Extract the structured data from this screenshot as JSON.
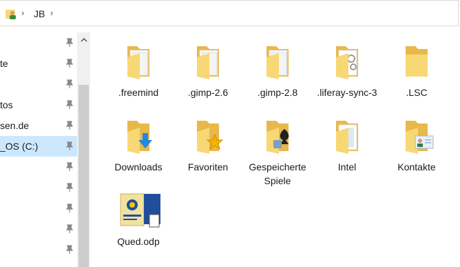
{
  "address": {
    "crumb": "JB"
  },
  "nav": {
    "items": [
      {
        "label": ""
      },
      {
        "label": "te"
      },
      {
        "label": ""
      },
      {
        "label": "tos"
      },
      {
        "label": "sen.de"
      },
      {
        "label": "_OS (C:)"
      },
      {
        "label": ""
      },
      {
        "label": ""
      },
      {
        "label": ""
      },
      {
        "label": ""
      },
      {
        "label": ""
      }
    ]
  },
  "files": [
    {
      "name": ".freemind",
      "icon": "folder-icon"
    },
    {
      "name": ".gimp-2.6",
      "icon": "folder-icon"
    },
    {
      "name": ".gimp-2.8",
      "icon": "folder-icon"
    },
    {
      "name": ".liferay-sync-3",
      "icon": "folder-gears-icon"
    },
    {
      "name": ".LSC",
      "icon": "empty-folder-icon"
    },
    {
      "name": "Downloads",
      "icon": "downloads-folder-icon"
    },
    {
      "name": "Favoriten",
      "icon": "favorites-folder-icon"
    },
    {
      "name": "Gespeicherte Spiele",
      "icon": "saved-games-folder-icon"
    },
    {
      "name": "Intel",
      "icon": "folder-icon"
    },
    {
      "name": "Kontakte",
      "icon": "contacts-folder-icon"
    },
    {
      "name": "Qued.odp",
      "icon": "odp-document-icon"
    }
  ],
  "colors": {
    "selection": "#cce8ff",
    "folder": "#f8d775",
    "folder_dark": "#e8b84a"
  }
}
